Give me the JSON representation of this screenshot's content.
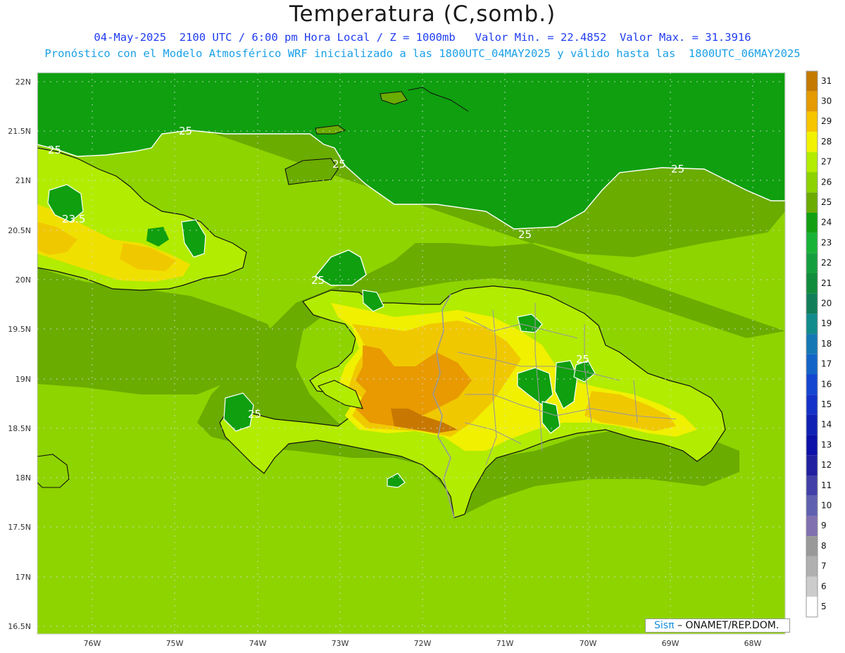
{
  "header": {
    "title": "Temperatura (C,somb.)",
    "line1": "04-May-2025  2100 UTC / 6:00 pm Hora Local / Z = 1000mb   Valor Min. = 22.4852  Valor Max. = 31.3916",
    "line2": "Pronóstico con el Modelo Atmosférico WRF inicializado a las 1800UTC_04MAY2025 y válido hasta las  1800UTC_06MAY2025"
  },
  "map": {
    "lat_labels": [
      "22N",
      "21.5N",
      "21N",
      "20.5N",
      "20N",
      "19.5N",
      "19N",
      "18.5N",
      "18N",
      "17.5N",
      "17N",
      "16.5N"
    ],
    "lon_labels": [
      "76W",
      "75W",
      "74W",
      "73W",
      "72W",
      "71W",
      "70W",
      "69W",
      "68W"
    ],
    "contour_labels": [
      {
        "id": "c1",
        "text": "25"
      },
      {
        "id": "c2",
        "text": "25"
      },
      {
        "id": "c3",
        "text": "25"
      },
      {
        "id": "c4",
        "text": "25"
      },
      {
        "id": "c5",
        "text": "25"
      },
      {
        "id": "c6",
        "text": "25"
      },
      {
        "id": "c7",
        "text": "25"
      },
      {
        "id": "c8",
        "text": "25"
      },
      {
        "id": "c9",
        "text": "23.5"
      }
    ],
    "colors": {
      "sea_cold": "#0f9f0f",
      "sea_mid": "#6aac00",
      "sea_warm": "#8ed400",
      "land_27": "#b2ec00",
      "land_28": "#f0f000",
      "land_29": "#f0c800",
      "land_30": "#e89a00",
      "land_31": "#c87800"
    }
  },
  "colorbar": {
    "labels": [
      "31",
      "30",
      "29",
      "28",
      "27",
      "26",
      "25",
      "24",
      "23",
      "22",
      "21",
      "20",
      "19",
      "18",
      "17",
      "16",
      "15",
      "14",
      "13",
      "12",
      "11",
      "10",
      "9",
      "8",
      "7",
      "6",
      "5"
    ],
    "colors": [
      "#c47a00",
      "#e49a00",
      "#f7c400",
      "#f2f200",
      "#b4ec00",
      "#8cd200",
      "#6aac00",
      "#12a012",
      "#17b337",
      "#149f3e",
      "#0f8c3c",
      "#0f7f5a",
      "#108c8c",
      "#1478b4",
      "#1464c8",
      "#1446d2",
      "#1432c8",
      "#1020b4",
      "#0c10a8",
      "#2020a0",
      "#4040a8",
      "#6060b0",
      "#8070b0",
      "#999999",
      "#b0b0b0",
      "#cccccc",
      "#ffffff"
    ]
  },
  "credit": {
    "brand": "Sisπ",
    "text": " – ONAMET/REP.DOM."
  }
}
